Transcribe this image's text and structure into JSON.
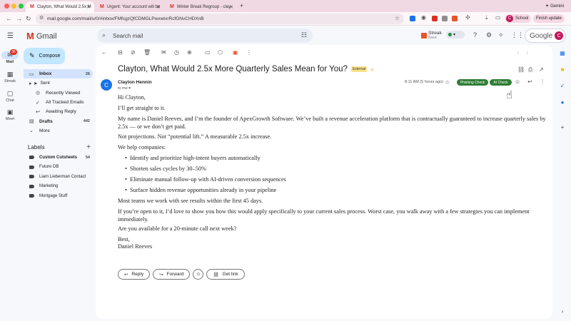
{
  "browser": {
    "tabs": [
      {
        "title": "Clayton, What Would 2.5x M",
        "active": true
      },
      {
        "title": "Urgent: Your account will be",
        "active": false
      },
      {
        "title": "Winter Break Regroup - clay",
        "active": false
      }
    ],
    "gemini_label": "Gemini",
    "url": "mail.google.com/mail/u/0/#inbox/FMfcgzQfCDMGLPwxwtxrRcfGNvCHDXnB",
    "profile_initial": "C",
    "profile_label": "School",
    "finish_update_label": "Finish update",
    "colors": {
      "tabbar": "#f0d9e3",
      "profile": "#c2185b"
    }
  },
  "gmail": {
    "brand": "Gmail",
    "search_placeholder": "Search mail",
    "streak": {
      "name": "Streak",
      "plan": "Basic"
    },
    "google_label": "Google",
    "account_initial": "C"
  },
  "rail": {
    "items": [
      {
        "label": "Mail",
        "icon": "mail-icon",
        "badge": "36"
      },
      {
        "label": "Streak",
        "icon": "streak-icon"
      },
      {
        "label": "Chat",
        "icon": "chat-icon"
      },
      {
        "label": "Meet",
        "icon": "video-icon"
      }
    ]
  },
  "sidebar": {
    "compose_label": "Compose",
    "nav": [
      {
        "label": "Inbox",
        "count": "26"
      },
      {
        "label": "Sent",
        "count": ""
      },
      {
        "label": "Recently Viewed",
        "count": ""
      },
      {
        "label": "All Tracked Emails",
        "count": ""
      },
      {
        "label": "Awaiting Reply",
        "count": ""
      },
      {
        "label": "Drafts",
        "count": "442"
      },
      {
        "label": "More",
        "count": ""
      }
    ],
    "labels_heading": "Labels",
    "labels": [
      {
        "label": "Custom Cutsheets",
        "count": "54"
      },
      {
        "label": "Future DB",
        "count": ""
      },
      {
        "label": "Liam Lieberman Contact",
        "count": ""
      },
      {
        "label": "Marketing",
        "count": ""
      },
      {
        "label": "Mortgage Stuff",
        "count": ""
      }
    ]
  },
  "email": {
    "subject": "Clayton, What Would 2.5x More Quarterly Sales Mean for You?",
    "external_badge": "External",
    "sender_initial": "C",
    "sender": "Clayton Hennin",
    "to": "to me",
    "datetime": "8:11 AM (5 hours ago)",
    "phishing_check_label": "Phishing Check",
    "ai_check_label": "AI Check",
    "greeting": "Hi Clayton,",
    "p1": "I’ll get straight to it.",
    "p2": "My name is Daniel Reeves, and I’m the founder of ApexGrowth Software. We’ve built a revenue acceleration platform that is contractually guaranteed to increase quarterly sales by 2.5x — or we don’t get paid.",
    "p3": "Not projections. Not “potential lift.” A measurable 2.5x increase.",
    "p4": "We help companies:",
    "bullets": [
      "Identify and prioritize high-intent buyers automatically",
      "Shorten sales cycles by 30–50%",
      "Eliminate manual follow-up with AI-driven conversion sequences",
      "Surface hidden revenue opportunities already in your pipeline"
    ],
    "p5": "Most teams we work with see results within the first 45 days.",
    "p6": "If you’re open to it, I’d love to show you how this would apply specifically to your current sales process. Worst case, you walk away with a few strategies you can implement immediately.",
    "p7": "Are you available for a 20-minute call next week?",
    "signoff": "Best,",
    "signature": "Daniel Reeves",
    "reply_label": "Reply",
    "forward_label": "Forward",
    "get_link_label": "Get link"
  }
}
